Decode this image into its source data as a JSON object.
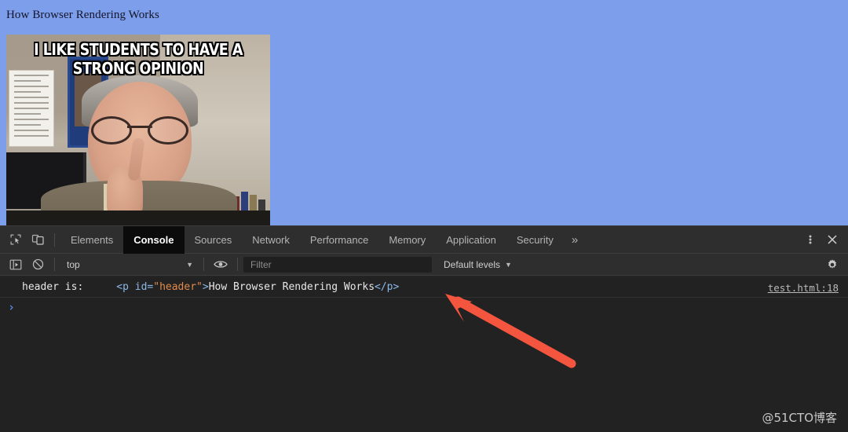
{
  "page": {
    "title": "How Browser Rendering Works",
    "background_color": "#7d9eea",
    "meme": {
      "caption_line1": "I LIKE STUDENTS TO HAVE A",
      "caption_line2": "STRONG OPINION",
      "alt": "meme-photo-professor"
    }
  },
  "devtools": {
    "tabs": [
      {
        "label": "Elements",
        "active": false
      },
      {
        "label": "Console",
        "active": true
      },
      {
        "label": "Sources",
        "active": false
      },
      {
        "label": "Network",
        "active": false
      },
      {
        "label": "Performance",
        "active": false
      },
      {
        "label": "Memory",
        "active": false
      },
      {
        "label": "Application",
        "active": false
      },
      {
        "label": "Security",
        "active": false
      }
    ],
    "more_tabs_label": "»",
    "icons": {
      "inspect": "inspect-element-icon",
      "device": "device-toolbar-icon",
      "kebab": "more-options-icon",
      "close": "close-devtools-icon",
      "sidebar": "console-sidebar-icon",
      "clear": "clear-console-icon",
      "eye": "live-expression-icon",
      "gear": "settings-icon"
    },
    "console_toolbar": {
      "context": "top",
      "context_caret": "▼",
      "filter_placeholder": "Filter",
      "filter_value": "",
      "levels": "Default levels",
      "levels_caret": "▼"
    },
    "console_output": [
      {
        "label": "header is:",
        "markup": {
          "open_tag": "<p",
          "attr_name": " id=",
          "attr_value": "\"header\"",
          "gt": ">",
          "text": "How Browser Rendering Works",
          "close_tag": "</p>"
        },
        "source": "test.html:18"
      }
    ],
    "prompt": {
      "caret": "›",
      "value": "",
      "placeholder": ""
    },
    "colors": {
      "toolbar_bg": "#2e2e2e",
      "console_bg": "#222222",
      "active_tab_bg": "#0b0b0b",
      "tag_color": "#8bb8e8",
      "attr_value_color": "#e08b4c",
      "prompt_color": "#5b87e0",
      "annotation_arrow": "#f4553f"
    }
  },
  "annotation": {
    "arrow_color": "#f4553f",
    "arrow_name": "red-pointer-arrow"
  },
  "watermark": {
    "text": "@51CTO博客"
  }
}
